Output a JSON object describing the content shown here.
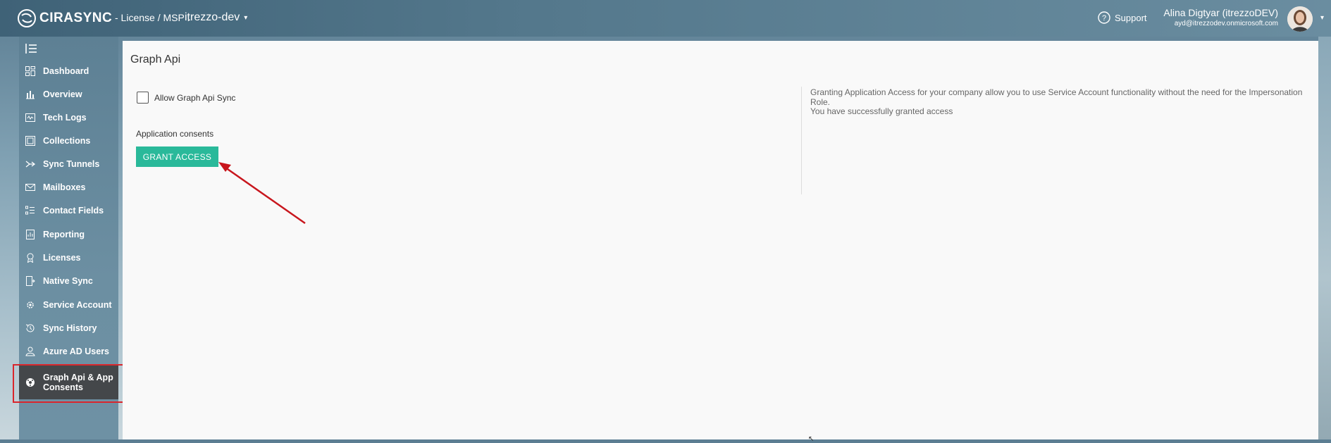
{
  "header": {
    "brand": "CIRASYNC",
    "breadcrumb": "- License / MSP :",
    "org": "itrezzo-dev",
    "support_label": "Support",
    "user_name": "Alina Digtyar (itrezzoDEV)",
    "user_email": "ayd@itrezzodev.onmicrosoft.com"
  },
  "sidebar": {
    "items": [
      {
        "label": "Dashboard",
        "icon": "dashboard-icon"
      },
      {
        "label": "Overview",
        "icon": "bar-chart-icon"
      },
      {
        "label": "Tech Logs",
        "icon": "log-icon"
      },
      {
        "label": "Collections",
        "icon": "collections-icon"
      },
      {
        "label": "Sync Tunnels",
        "icon": "tunnel-icon"
      },
      {
        "label": "Mailboxes",
        "icon": "envelope-icon"
      },
      {
        "label": "Contact Fields",
        "icon": "fields-icon"
      },
      {
        "label": "Reporting",
        "icon": "report-icon"
      },
      {
        "label": "Licenses",
        "icon": "badge-icon"
      },
      {
        "label": "Native Sync",
        "icon": "native-sync-icon"
      },
      {
        "label": "Service Account",
        "icon": "gear-user-icon"
      },
      {
        "label": "Sync History",
        "icon": "history-icon"
      },
      {
        "label": "Azure AD Users",
        "icon": "users-icon"
      },
      {
        "label": "Graph Api & App Consents",
        "icon": "graph-icon"
      }
    ],
    "active_index": 13
  },
  "main": {
    "title": "Graph Api",
    "checkbox_label": "Allow Graph Api Sync",
    "checkbox_checked": false,
    "consents_label": "Application consents",
    "grant_button": "GRANT ACCESS",
    "info_text": "Granting Application Access for your company allow you to use Service Account functionality without the need for the Impersonation Role.",
    "status_text": "You have successfully granted access"
  },
  "colors": {
    "accent": "#2ab99a",
    "annotation": "#d9262c",
    "active_nav": "#44474a"
  }
}
